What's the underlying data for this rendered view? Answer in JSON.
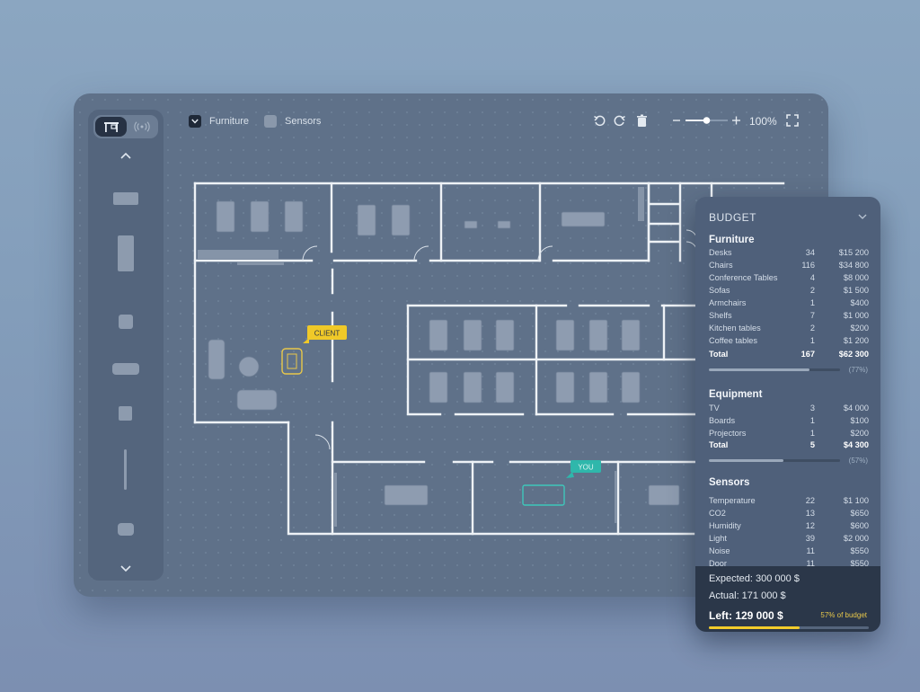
{
  "toolbar": {
    "layers": [
      {
        "label": "Furniture",
        "checked": true
      },
      {
        "label": "Sensors",
        "checked": false
      }
    ],
    "zoom": "100%",
    "zoom_level": 0.5
  },
  "sidebar": {
    "modes": [
      "furniture-mode",
      "sensors-mode"
    ],
    "active_mode": "furniture-mode",
    "palette": [
      "desk-icon",
      "long-table-icon",
      "chair-icon",
      "sofa-icon",
      "cabinet-icon",
      "wall-panel-icon",
      "armchair-icon"
    ]
  },
  "floorplan": {
    "client_tag": "CLIENT",
    "you_tag": "YOU"
  },
  "budget": {
    "title": "BUDGET",
    "sections": [
      {
        "title": "Furniture",
        "rows": [
          {
            "name": "Desks",
            "qty": "34",
            "cost": "$15 200"
          },
          {
            "name": "Chairs",
            "qty": "116",
            "cost": "$34 800"
          },
          {
            "name": "Conference Tables",
            "qty": "4",
            "cost": "$8 000"
          },
          {
            "name": "Sofas",
            "qty": "2",
            "cost": "$1 500"
          },
          {
            "name": "Armchairs",
            "qty": "1",
            "cost": "$400"
          },
          {
            "name": "Shelfs",
            "qty": "7",
            "cost": "$1 000"
          },
          {
            "name": "Kitchen tables",
            "qty": "2",
            "cost": "$200"
          },
          {
            "name": "Coffee tables",
            "qty": "1",
            "cost": "$1 200"
          }
        ],
        "total": {
          "name": "Total",
          "qty": "167",
          "cost": "$62 300"
        },
        "progress": 0.77,
        "progress_label": "(77%)"
      },
      {
        "title": "Equipment",
        "rows": [
          {
            "name": "TV",
            "qty": "3",
            "cost": "$4 000"
          },
          {
            "name": "Boards",
            "qty": "1",
            "cost": "$100"
          },
          {
            "name": "Projectors",
            "qty": "1",
            "cost": "$200"
          }
        ],
        "total": {
          "name": "Total",
          "qty": "5",
          "cost": "$4 300"
        },
        "progress": 0.57,
        "progress_label": "(57%)"
      },
      {
        "title": "Sensors",
        "rows": [
          {
            "name": "Temperature",
            "qty": "22",
            "cost": "$1 100"
          },
          {
            "name": "CO2",
            "qty": "13",
            "cost": "$650"
          },
          {
            "name": "Humidity",
            "qty": "12",
            "cost": "$600"
          },
          {
            "name": "Light",
            "qty": "39",
            "cost": "$2 000"
          },
          {
            "name": "Noise",
            "qty": "11",
            "cost": "$550"
          },
          {
            "name": "Door",
            "qty": "11",
            "cost": "$550"
          }
        ]
      }
    ],
    "summary": {
      "expected": "Expected: 300 000 $",
      "actual": "Actual: 171 000 $",
      "left": "Left: 129 000 $",
      "note": "57% of budget",
      "progress": 0.57
    }
  }
}
